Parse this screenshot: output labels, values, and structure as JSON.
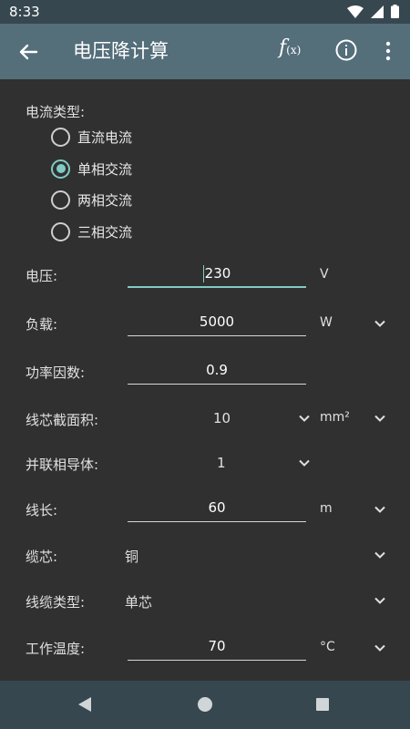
{
  "status_bar": {
    "time": "8:33"
  },
  "app_bar": {
    "title": "电压降计算",
    "fx_f": "f",
    "fx_x": "(x)"
  },
  "current_type": {
    "label": "电流类型:",
    "options": [
      "直流电流",
      "单相交流",
      "两相交流",
      "三相交流"
    ],
    "selected_index": 1
  },
  "voltage": {
    "label": "电压:",
    "value": "230",
    "unit": "V"
  },
  "load": {
    "label": "负载:",
    "value": "5000",
    "unit": "W"
  },
  "power_factor": {
    "label": "功率因数:",
    "value": "0.9"
  },
  "cross_section": {
    "label": "线芯截面积:",
    "value": "10",
    "unit": "mm²"
  },
  "parallel_conductors": {
    "label": "并联相导体:",
    "value": "1"
  },
  "length": {
    "label": "线长:",
    "value": "60",
    "unit": "m"
  },
  "core": {
    "label": "缆芯:",
    "value": "铜"
  },
  "cable_type": {
    "label": "线缆类型:",
    "value": "单芯"
  },
  "temperature": {
    "label": "工作温度:",
    "value": "70",
    "unit": "°C"
  },
  "colors": {
    "accent": "#80cbc4",
    "app_bar": "#546e7a",
    "status_bar": "#37474f",
    "background": "#303030"
  }
}
